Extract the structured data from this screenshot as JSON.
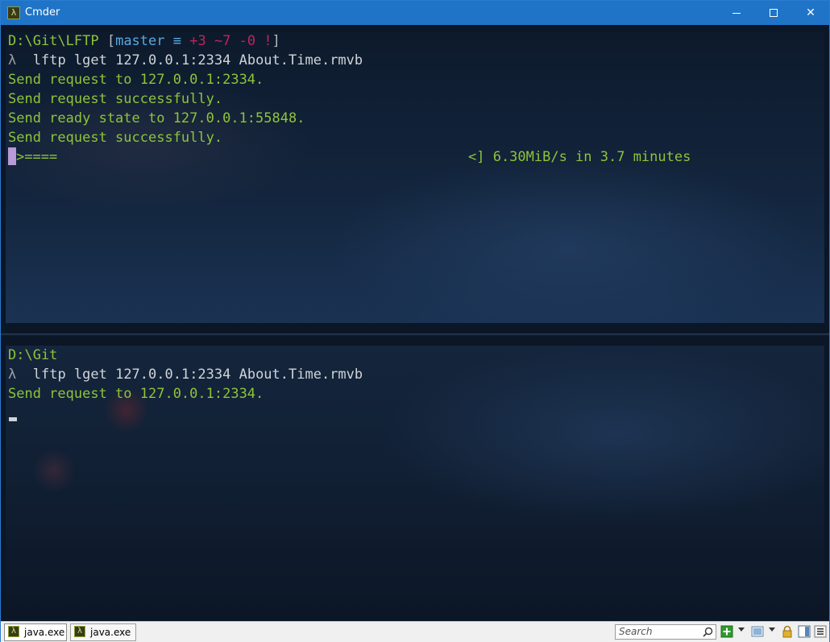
{
  "window": {
    "title": "Cmder",
    "app_icon_glyph": "λ",
    "controls": [
      "minimize-icon",
      "maximize-icon",
      "close-icon"
    ]
  },
  "top_pane": {
    "prompt_path": "D:\\Git\\LFTP",
    "git_open": " [",
    "git_branch": "master",
    "git_sync": " ≡ ",
    "git_added": "+3",
    "git_modified": " ~7",
    "git_deleted": " -0",
    "git_conflict": " !",
    "git_close": "]",
    "lambda": "λ",
    "command": "lftp lget 127.0.0.1:2334 About.Time.rmvb",
    "output": [
      "Send request to 127.0.0.1:2334.",
      "Send request successfully.",
      "Send ready state to 127.0.0.1:55848.",
      "Send request successfully."
    ],
    "progress_bar": ">====",
    "progress_status": "<] 6.30MiB/s in 3.7 minutes"
  },
  "bottom_pane": {
    "prompt_path": "D:\\Git",
    "lambda": "λ",
    "command": "lftp lget 127.0.0.1:2334 About.Time.rmvb",
    "output": [
      "Send request to 127.0.0.1:2334."
    ]
  },
  "statusbar": {
    "tabs": [
      {
        "label": "java.exe",
        "active": true
      },
      {
        "label": "java.exe",
        "active": false
      }
    ],
    "search_placeholder": "Search",
    "icons": [
      "new-console-icon",
      "dropdown-icon",
      "view-icon",
      "dropdown-icon",
      "lock-icon",
      "layout-icon",
      "menu-icon"
    ]
  },
  "colors": {
    "titlebar": "#1f74c8",
    "prompt_green": "#8ec43a",
    "branch_blue": "#59a9e0",
    "git_status_pink": "#c0245c",
    "cursor": "#b79ad6"
  }
}
